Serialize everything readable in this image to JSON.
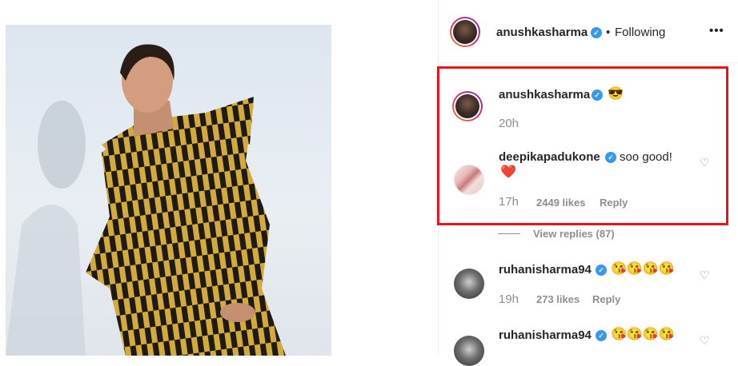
{
  "header": {
    "username": "anushkasharma",
    "follow_separator": "•",
    "follow_status": "Following",
    "more_label": "•••"
  },
  "comments": [
    {
      "username": "anushkasharma",
      "emoji": "😎",
      "time": "20h"
    },
    {
      "username": "deepikapadukone",
      "text": "soo good!",
      "emoji": "❤️",
      "time": "17h",
      "likes": "2449 likes",
      "reply": "Reply"
    }
  ],
  "view_replies": "View replies (87)",
  "more_comments": [
    {
      "username": "ruhanisharma94",
      "emojis": "😘😘😘😘",
      "time": "19h",
      "likes": "273 likes",
      "reply": "Reply"
    },
    {
      "username": "ruhanisharma94",
      "emojis": "😘😘😘😘"
    }
  ],
  "colors": {
    "highlight": "#e8141a",
    "verified": "#3897f0",
    "muted": "#8e8e8e"
  }
}
